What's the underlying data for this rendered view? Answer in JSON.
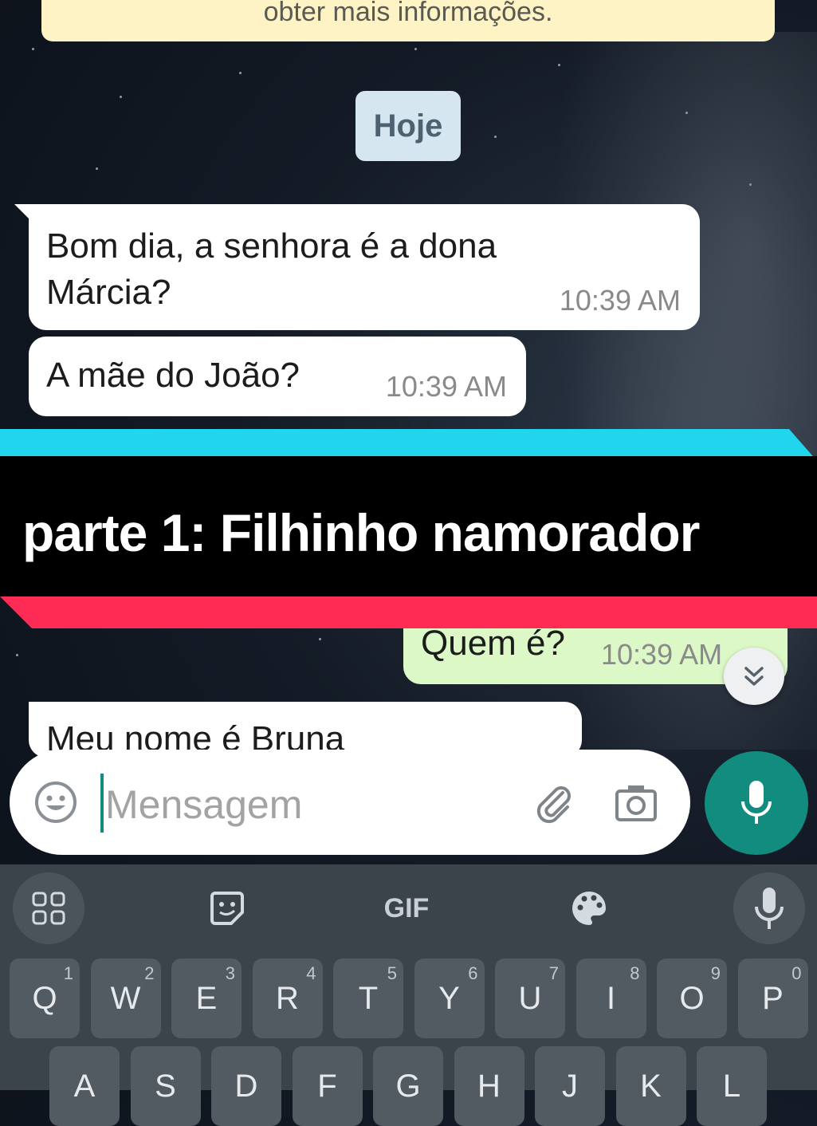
{
  "notice": {
    "text": "obter mais informações."
  },
  "date_chip": "Hoje",
  "messages": [
    {
      "text": "Bom dia, a senhora é a dona Márcia?",
      "time": "10:39 AM",
      "direction": "in"
    },
    {
      "text": "A mãe do João?",
      "time": "10:39 AM",
      "direction": "in"
    },
    {
      "text": "Quem é?",
      "time": "10:39 AM",
      "direction": "out"
    },
    {
      "text": "Meu nome é Bruna",
      "direction": "in"
    }
  ],
  "banner": {
    "text": "parte 1: Filhinho namorador"
  },
  "composer": {
    "placeholder": "Mensagem"
  },
  "keyboard": {
    "gif_label": "GIF",
    "row1": [
      {
        "key": "Q",
        "alt": "1"
      },
      {
        "key": "W",
        "alt": "2"
      },
      {
        "key": "E",
        "alt": "3"
      },
      {
        "key": "R",
        "alt": "4"
      },
      {
        "key": "T",
        "alt": "5"
      },
      {
        "key": "Y",
        "alt": "6"
      },
      {
        "key": "U",
        "alt": "7"
      },
      {
        "key": "I",
        "alt": "8"
      },
      {
        "key": "O",
        "alt": "9"
      },
      {
        "key": "P",
        "alt": "0"
      }
    ],
    "row2": [
      "A",
      "S",
      "D",
      "F",
      "G",
      "H",
      "J",
      "K",
      "L"
    ]
  },
  "colors": {
    "whatsapp_green": "#128c7e",
    "outgoing_bubble": "#dcf8c6",
    "banner_cyan": "#20d5ec",
    "banner_red": "#fe2c55"
  },
  "icons": [
    "emoji-icon",
    "attach-icon",
    "camera-icon",
    "mic-icon",
    "scroll-down-icon",
    "apps-grid-icon",
    "sticker-icon",
    "palette-icon"
  ]
}
